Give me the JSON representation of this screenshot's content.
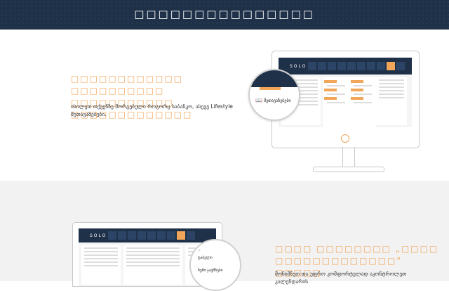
{
  "header": {
    "title": "□□□□□□□□□□□□□□□"
  },
  "section1": {
    "heading_line1": "□□□□□□□□□□□□ □□□□□□□□□□",
    "heading_line2": "□□□□□□□□□□□ □□□□□□□□□□□□□",
    "body_line1": "ისილეთ თქვენზე მორგებული როგორც საბანკო, ასევე Lifestyle",
    "body_line2": "შეთავაზებები."
  },
  "monitor_app": {
    "logo": "SOLO",
    "magnifier_label": "შეთავაზებები"
  },
  "section2": {
    "heading_line1": "□□□□ □□□□□□□□ „□□□□",
    "heading_line2": "□□□□□□□□□□□□□\" □□□□□",
    "body_line1": "მონიშნეთ და უფრო კომფორტულად აკონტროლეთ კალენდარის"
  },
  "laptop_app": {
    "logo": "SOLO",
    "mag_line1": "ტაბელი",
    "mag_line2": "ჩემი ჯავშნები"
  },
  "colors": {
    "brand_navy": "#1f3149",
    "accent_orange": "#f2a65a"
  }
}
